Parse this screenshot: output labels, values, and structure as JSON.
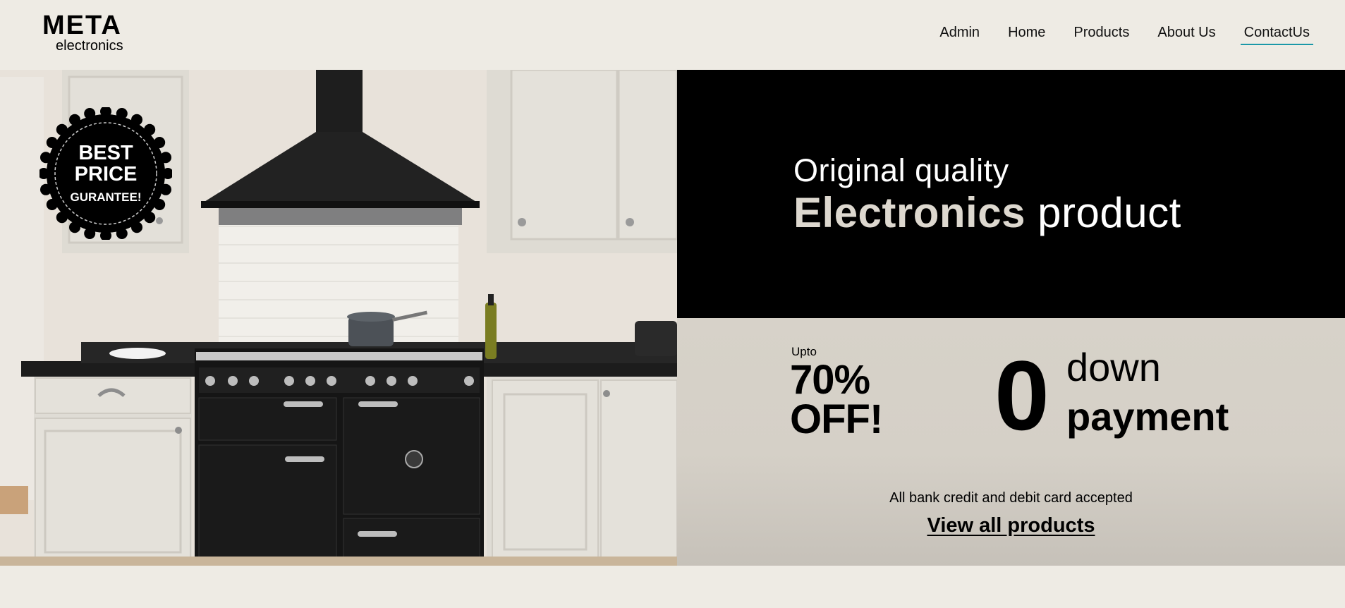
{
  "brand": {
    "name": "META",
    "tagline": "electronics"
  },
  "nav": {
    "items": [
      {
        "label": "Admin"
      },
      {
        "label": "Home"
      },
      {
        "label": "Products"
      },
      {
        "label": "About Us"
      },
      {
        "label": "ContactUs",
        "active": true
      }
    ]
  },
  "badge": {
    "line1": "BEST",
    "line2": "PRICE",
    "line3": "GURANTEE!"
  },
  "hero": {
    "line1": "Original quality",
    "line2_bold": "Electronics",
    "line2_rest": " product"
  },
  "offer": {
    "upto": "Upto",
    "percent": "70%",
    "off": "OFF!",
    "zero": "0",
    "down": "down",
    "payment": "payment",
    "cards_note": "All bank credit and debit card accepted",
    "cta": "View all products"
  },
  "colors": {
    "background": "#eeebe4",
    "accent": "#1b98a8",
    "dark_panel": "#000000",
    "light_panel": "#d7d2c9"
  }
}
